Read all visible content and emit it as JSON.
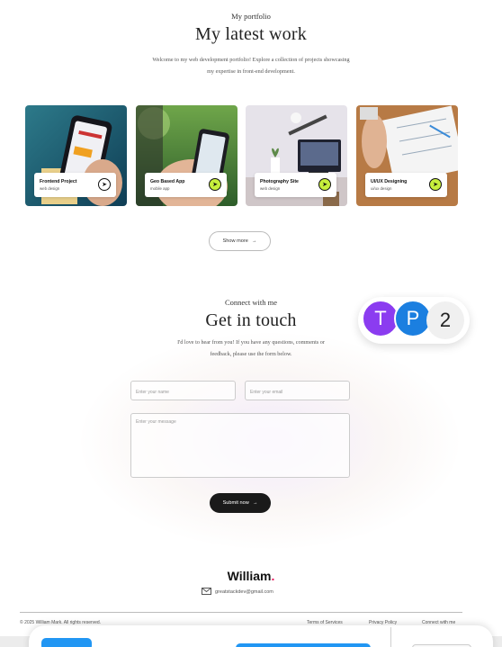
{
  "portfolio": {
    "eyebrow": "My portfolio",
    "title": "My latest work",
    "intro_line1": "Welcome to my web development portfolio! Explore a collection of projects showcasing",
    "intro_line2": "my expertise in front-end development.",
    "projects": [
      {
        "title": "Frontend Project",
        "category": "web design",
        "arrow_icon": "arrow-icon",
        "accent": "#ffffff"
      },
      {
        "title": "Geo Based App",
        "category": "mobile app",
        "arrow_icon": "arrow-icon",
        "accent": "#c7ee3c"
      },
      {
        "title": "Photography Site",
        "category": "web design",
        "arrow_icon": "arrow-icon",
        "accent": "#c7ee3c"
      },
      {
        "title": "UI/UX Designing",
        "category": "ui/ux design",
        "arrow_icon": "arrow-icon",
        "accent": "#c7ee3c"
      }
    ],
    "show_more_label": "Show more",
    "show_more_icon": "arrow-right-icon"
  },
  "contact": {
    "eyebrow": "Connect with me",
    "title": "Get in touch",
    "intro_line1": "I'd love to hear from you! If you have any questions, comments or",
    "intro_line2": "feedback, please use the form below.",
    "name_placeholder": "Enter your name",
    "email_placeholder": "Enter your email",
    "message_placeholder": "Enter your message",
    "submit_label": "Submit now",
    "submit_icon": "arrow-right-icon"
  },
  "presence": {
    "avatars": [
      {
        "initial": "T",
        "color": "#8b3cf0"
      },
      {
        "initial": "P",
        "color": "#1b7fe0"
      }
    ],
    "extra_count": "2"
  },
  "footer": {
    "brand": "William",
    "brand_dot": ".",
    "brand_dot_color": "#e8185c",
    "email": "greatstackdev@gmail.com",
    "email_icon": "mail-icon",
    "copyright": "© 2025 William Mark. All rights reserved.",
    "links": [
      "Terms of Services",
      "Privacy Policy",
      "Connect with me"
    ]
  }
}
